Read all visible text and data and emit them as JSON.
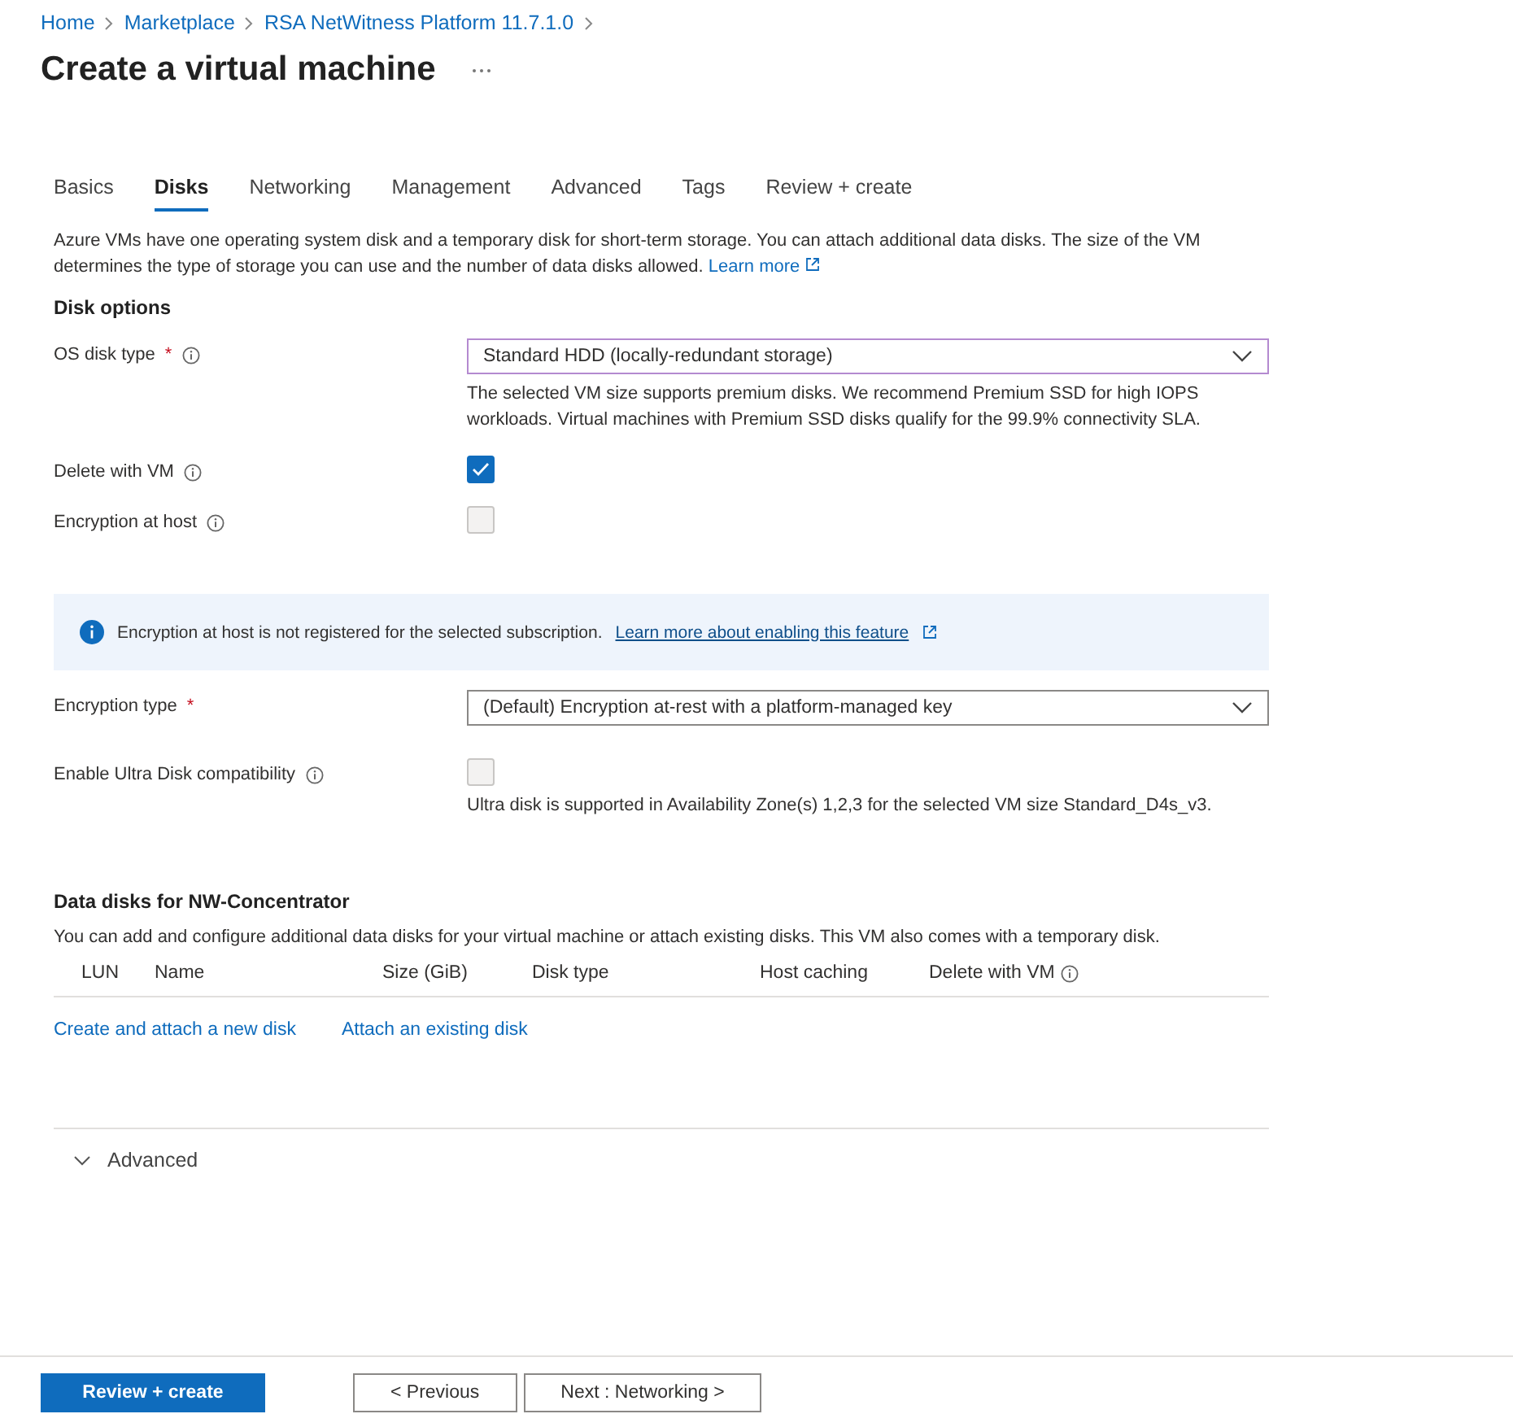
{
  "breadcrumb": [
    "Home",
    "Marketplace",
    "RSA NetWitness Platform 11.7.1.0"
  ],
  "title": "Create a virtual machine",
  "tabs": [
    {
      "label": "Basics",
      "selected": false
    },
    {
      "label": "Disks",
      "selected": true
    },
    {
      "label": "Networking",
      "selected": false
    },
    {
      "label": "Management",
      "selected": false
    },
    {
      "label": "Advanced",
      "selected": false
    },
    {
      "label": "Tags",
      "selected": false
    },
    {
      "label": "Review + create",
      "selected": false
    }
  ],
  "intro": {
    "text": "Azure VMs have one operating system disk and a temporary disk for short-term storage. You can attach additional data disks. The size of the VM determines the type of storage you can use and the number of data disks allowed.",
    "link": "Learn more"
  },
  "section_title": "Disk options",
  "fields": [
    {
      "kind": "dropdown",
      "label": "OS disk type",
      "required_mark": "*",
      "info": true,
      "value": "Standard HDD (locally-redundant storage)",
      "focused": true,
      "help": "The selected VM size supports premium disks. We recommend Premium SSD for high IOPS workloads. Virtual machines with Premium SSD disks qualify for the 99.9% connectivity SLA."
    },
    {
      "kind": "checkbox",
      "label": "Delete with VM",
      "info": true,
      "checked": true,
      "disabled": false
    },
    {
      "kind": "checkbox",
      "label": "Encryption at host",
      "info": true,
      "checked": false,
      "disabled": true
    },
    {
      "kind": "notice",
      "text": "Encryption at host is not registered for the selected subscription.",
      "link": "Learn more about enabling this feature"
    },
    {
      "kind": "dropdown",
      "label": "Encryption type",
      "required_mark": "*",
      "info": false,
      "value": "(Default) Encryption at-rest with a platform-managed key",
      "focused": false
    },
    {
      "kind": "checkbox",
      "label": "Enable Ultra Disk compatibility",
      "info": true,
      "checked": false,
      "disabled": true,
      "help": "Ultra disk is supported in Availability Zone(s) 1,2,3 for the selected VM size Standard_D4s_v3."
    }
  ],
  "data_disks": {
    "title": "Data disks for NW-Concentrator",
    "description": "You can add and configure additional data disks for your virtual machine or attach existing disks. This VM also comes with a temporary disk.",
    "columns": [
      {
        "label": "LUN",
        "info": false
      },
      {
        "label": "Name",
        "info": false
      },
      {
        "label": "Size (GiB)",
        "info": false
      },
      {
        "label": "Disk type",
        "info": false
      },
      {
        "label": "Host caching",
        "info": false
      },
      {
        "label": "Delete with VM",
        "info": true
      }
    ],
    "actions": [
      "Create and attach a new disk",
      "Attach an existing disk"
    ]
  },
  "advanced": {
    "label": "Advanced",
    "expanded": false
  },
  "buttons": [
    {
      "label": "Review + create",
      "kind": "primary"
    },
    {
      "label": "< Previous",
      "kind": "secondary"
    },
    {
      "label": "Next : Networking >",
      "kind": "secondary"
    }
  ]
}
